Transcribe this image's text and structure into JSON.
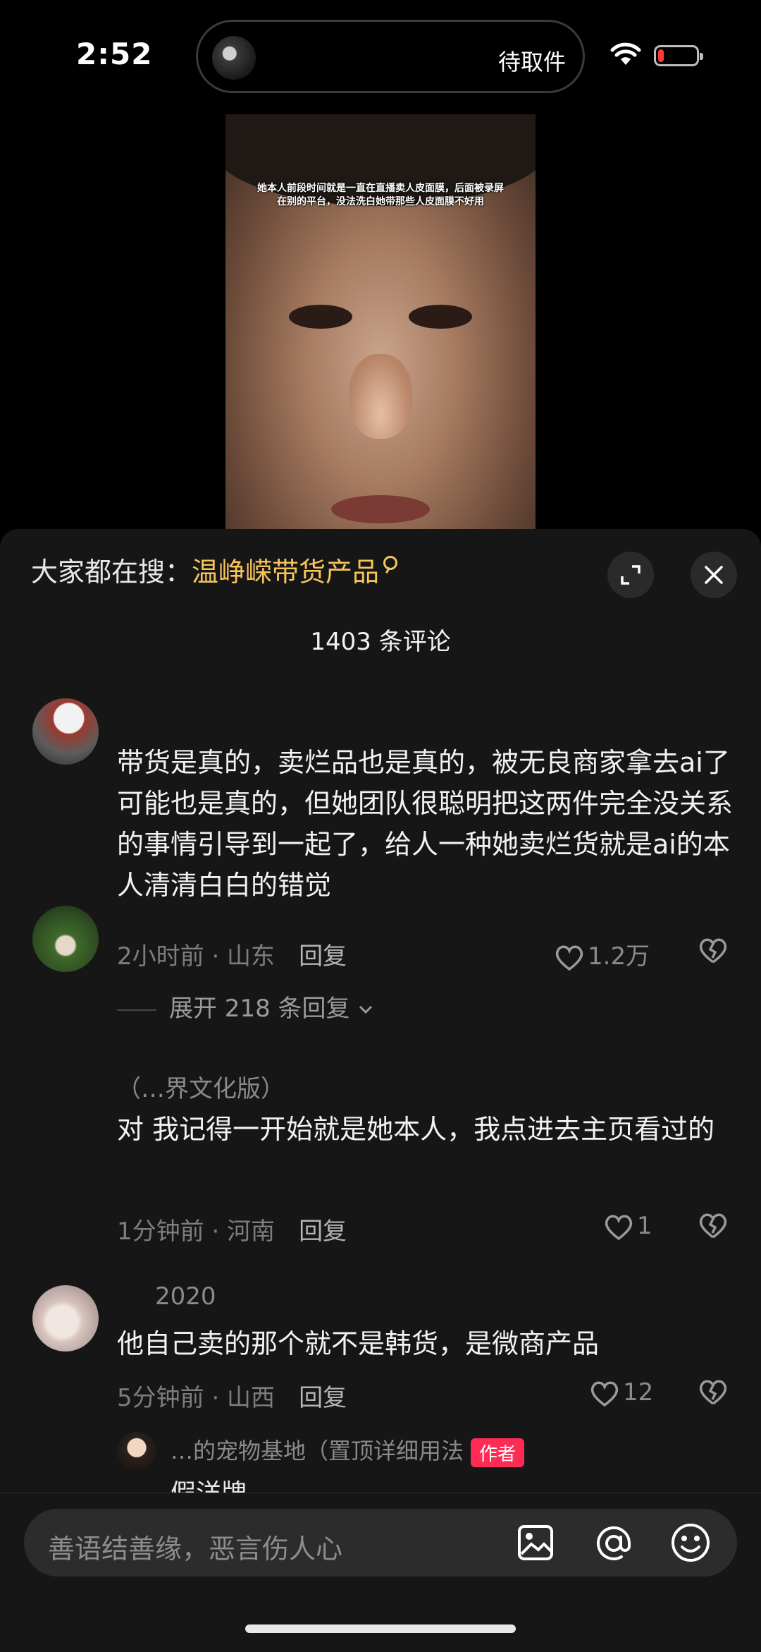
{
  "status_bar": {
    "time": "2:52",
    "island_label": "待取件",
    "battery_level": 0.15
  },
  "video": {
    "caption": "她本人前段时间就是一直在直播卖人皮面膜，后面被录屏在别的平台，没法洗白她带那些人皮面膜不好用"
  },
  "sheet": {
    "search_prefix": "大家都在搜：",
    "search_term": "温峥嵘带货产品",
    "comment_count": "1403 条评论"
  },
  "comments": [
    {
      "username": "",
      "text": "带货是真的，卖烂品也是真的，被无良商家拿去ai了可能也是真的，但她团队很聪明把这两件完全没关系的事情引导到一起了，给人一种她卖烂货就是ai的本人清清白白的错觉",
      "meta": "2小时前 · 山东",
      "reply": "回复",
      "likes": "1.2万",
      "expand": "展开 218 条回复"
    },
    {
      "username": "（…界文化版）",
      "text": "对 我记得一开始就是她本人，我点进去主页看过的",
      "meta": "1分钟前 · 河南",
      "reply": "回复",
      "likes": "1"
    },
    {
      "username": "2020",
      "text": "他自己卖的那个就不是韩货，是微商产品",
      "meta": "5分钟前 · 山西",
      "reply": "回复",
      "likes": "12",
      "sub_reply": {
        "name": "…的宠物基地（置顶详细用法",
        "badge": "作者",
        "text": "假洋牌"
      }
    }
  ],
  "input": {
    "placeholder": "善语结善缘，恶言伤人心"
  },
  "icons": {
    "wifi": "wifi-icon",
    "battery": "battery-icon",
    "expand": "expand-icon",
    "close": "close-icon",
    "heart": "heart-icon",
    "broken_heart": "broken-heart-icon",
    "chevron": "chevron-down-icon",
    "image": "image-icon",
    "at": "at-icon",
    "emoji": "emoji-icon",
    "search": "search-icon"
  },
  "colors": {
    "accent_search": "#f7c45a",
    "author_badge": "#fe2c55",
    "battery_low": "#ff3b30"
  }
}
